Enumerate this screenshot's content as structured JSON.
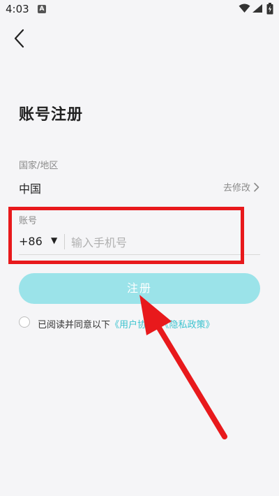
{
  "status_bar": {
    "time": "4:03",
    "notification_badge": "A"
  },
  "page": {
    "title": "账号注册"
  },
  "region": {
    "label": "国家/地区",
    "value": "中国",
    "modify_label": "去修改"
  },
  "account": {
    "label": "账号",
    "country_code": "+86",
    "caret": "▼",
    "phone_placeholder": "输入手机号",
    "phone_value": ""
  },
  "register_button": {
    "label": "注册"
  },
  "agreement": {
    "prefix": "已阅读并同意以下",
    "user_agreement": "《用户协议》",
    "privacy_policy": "《隐私政策》"
  },
  "colors": {
    "accent": "#3cc3cf",
    "button_bg": "#9be3e9",
    "annotation": "#e8191c",
    "background": "#f5f5f7"
  },
  "icons": {
    "back": "chevron-left-icon",
    "modify": "chevron-right-icon",
    "wifi": "wifi-icon",
    "signal": "signal-icon",
    "battery": "battery-icon"
  }
}
